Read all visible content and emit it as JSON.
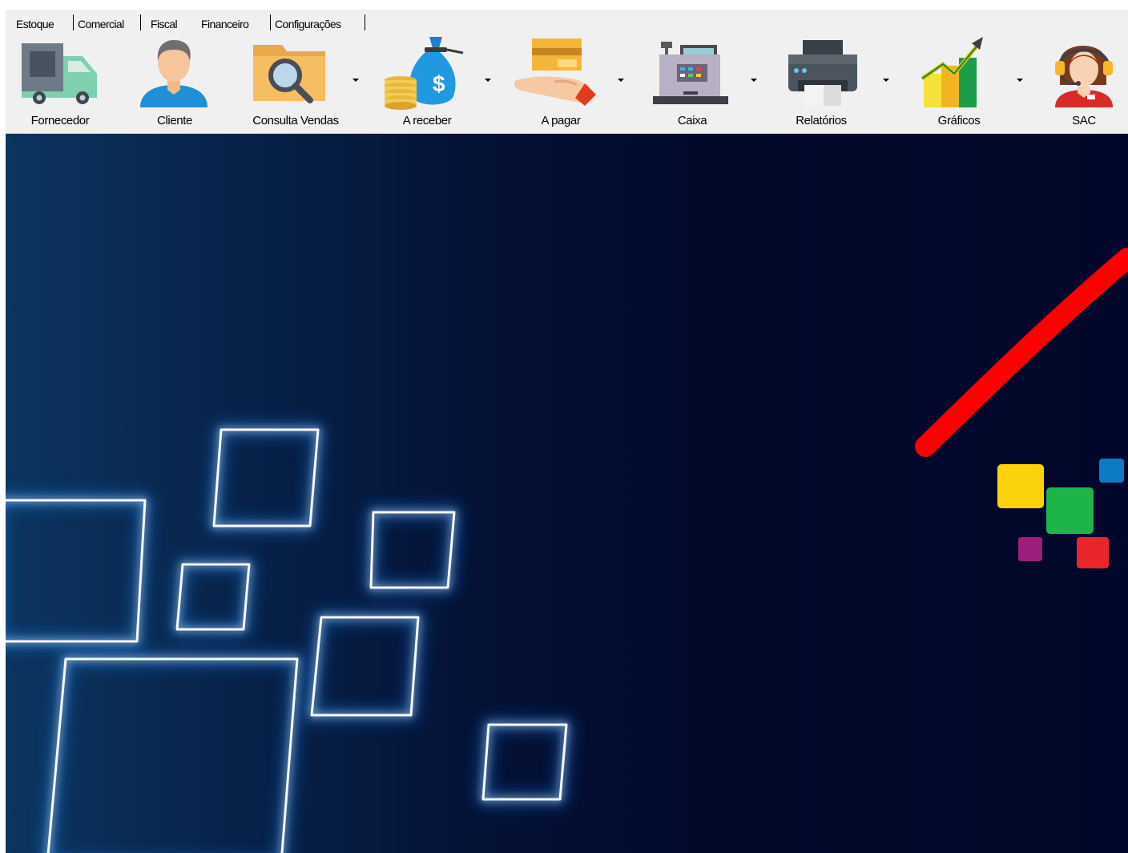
{
  "tabs": [
    "Estoque",
    "Comercial",
    "Fiscal",
    "Financeiro",
    "Configurações"
  ],
  "active_tab": "Financeiro",
  "toolbar": {
    "fornecedor": "Fornecedor",
    "cliente": "Cliente",
    "consulta_vendas": "Consulta Vendas",
    "a_receber": "A receber",
    "a_pagar": "A pagar",
    "caixa": "Caixa",
    "relatorios": "Relatórios",
    "graficos": "Gráficos",
    "sac": "SAC"
  },
  "colors": {
    "background_dark": "#01072a",
    "background_light": "#0c3560",
    "square_yellow": "#fcd30a",
    "square_green": "#1db54a",
    "square_blue": "#0a7bc4",
    "square_purple": "#9b1e7b",
    "square_red": "#e8262c",
    "stroke_red": "#ff0000"
  }
}
